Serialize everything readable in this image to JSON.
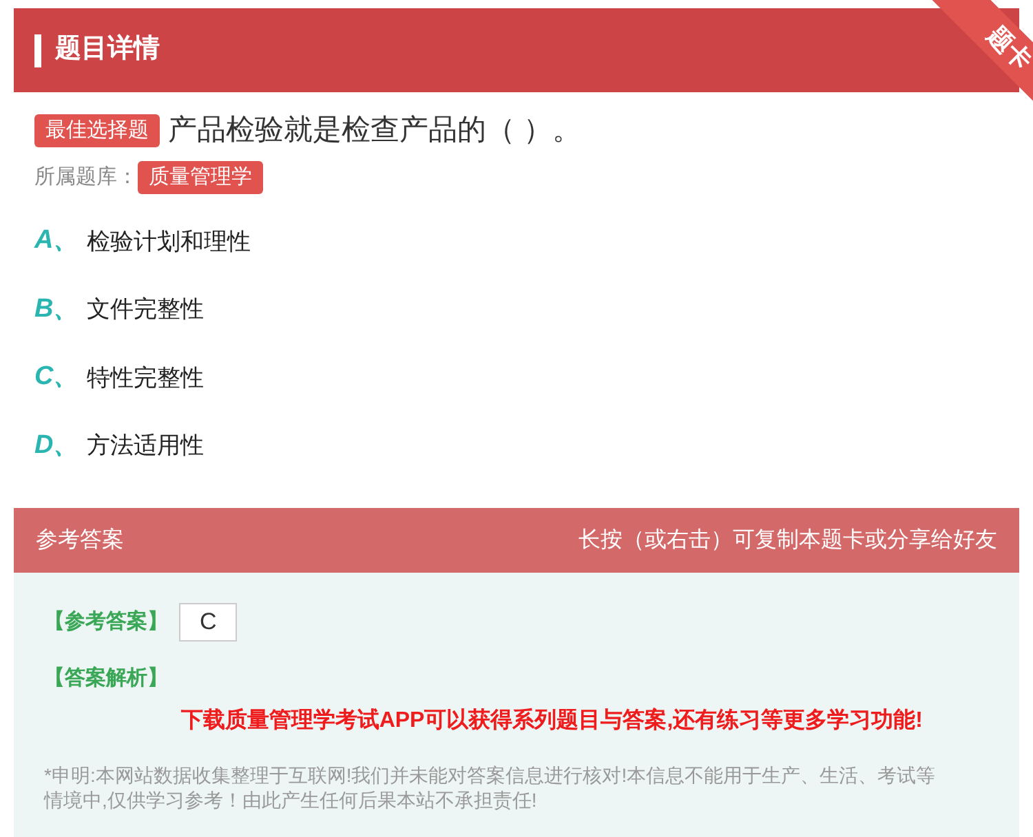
{
  "header": {
    "title": "题目详情",
    "ribbon": "题卡"
  },
  "question": {
    "type_badge": "最佳选择题",
    "text": "产品检验就是检查产品的（ ）。",
    "bank_label": "所属题库：",
    "bank": "质量管理学"
  },
  "options": [
    {
      "letter": "A、",
      "text": "检验计划和理性"
    },
    {
      "letter": "B、",
      "text": "文件完整性"
    },
    {
      "letter": "C、",
      "text": "特性完整性"
    },
    {
      "letter": "D、",
      "text": "方法适用性"
    }
  ],
  "answer_section": {
    "title": "参考答案",
    "hint": "长按（或右击）可复制本题卡或分享给好友",
    "answer_label": "【参考答案】",
    "answer": "C",
    "analysis_label": "【答案解析】",
    "promo": "下载质量管理学考试APP可以获得系列题目与答案,还有练习等更多学习功能!",
    "disclaimer": "*申明:本网站数据收集整理于互联网!我们并未能对答案信息进行核对!本信息不能用于生产、生活、考试等情境中,仅供学习参考！由此产生任何后果本站不承担责任!"
  }
}
